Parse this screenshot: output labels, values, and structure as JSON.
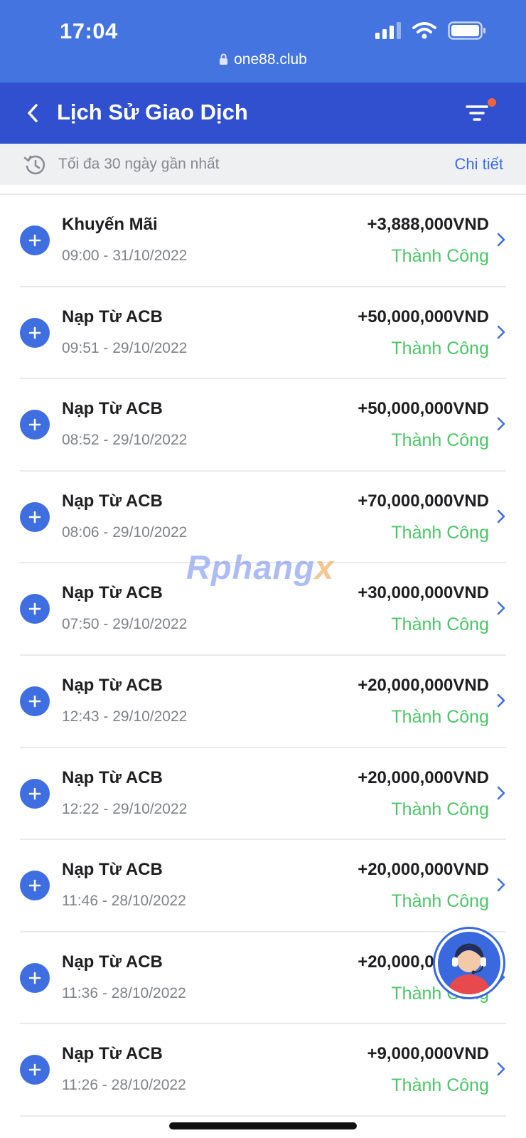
{
  "status_bar": {
    "time": "17:04",
    "url": "one88.club",
    "icons": [
      "signal-icon",
      "wifi-icon",
      "battery-icon",
      "lock-icon"
    ]
  },
  "header": {
    "title": "Lịch Sử Giao Dịch",
    "icons": [
      "back-icon",
      "filter-icon"
    ]
  },
  "info_bar": {
    "text": "Tối đa 30 ngày gần nhất",
    "detail_link": "Chi tiết",
    "icon": "history-icon"
  },
  "transactions": [
    {
      "name": "Khuyến Mãi",
      "datetime": "09:00 - 31/10/2022",
      "amount": "+3,888,000VND",
      "status": "Thành Công"
    },
    {
      "name": "Nạp Từ ACB",
      "datetime": "09:51 - 29/10/2022",
      "amount": "+50,000,000VND",
      "status": "Thành Công"
    },
    {
      "name": "Nạp Từ ACB",
      "datetime": "08:52 - 29/10/2022",
      "amount": "+50,000,000VND",
      "status": "Thành Công"
    },
    {
      "name": "Nạp Từ ACB",
      "datetime": "08:06 - 29/10/2022",
      "amount": "+70,000,000VND",
      "status": "Thành Công"
    },
    {
      "name": "Nạp Từ ACB",
      "datetime": "07:50 - 29/10/2022",
      "amount": "+30,000,000VND",
      "status": "Thành Công"
    },
    {
      "name": "Nạp Từ ACB",
      "datetime": "12:43 - 29/10/2022",
      "amount": "+20,000,000VND",
      "status": "Thành Công"
    },
    {
      "name": "Nạp Từ ACB",
      "datetime": "12:22 - 29/10/2022",
      "amount": "+20,000,000VND",
      "status": "Thành Công"
    },
    {
      "name": "Nạp Từ ACB",
      "datetime": "11:46 - 28/10/2022",
      "amount": "+20,000,000VND",
      "status": "Thành Công"
    },
    {
      "name": "Nạp Từ ACB",
      "datetime": "11:36 - 28/10/2022",
      "amount": "+20,000,000VND",
      "status": "Thành Công"
    },
    {
      "name": "Nạp Từ ACB",
      "datetime": "11:26 - 28/10/2022",
      "amount": "+9,000,000VND",
      "status": "Thành Công"
    }
  ],
  "watermark": {
    "main": "Rphang",
    "accent": "x"
  },
  "support_button": {
    "icon": "support-agent-icon"
  },
  "colors": {
    "status_bar": "#4474e0",
    "header": "#3150cf",
    "accent_blue": "#3f6ee0",
    "success_green": "#4cc566",
    "filter_badge": "#f0633f"
  }
}
